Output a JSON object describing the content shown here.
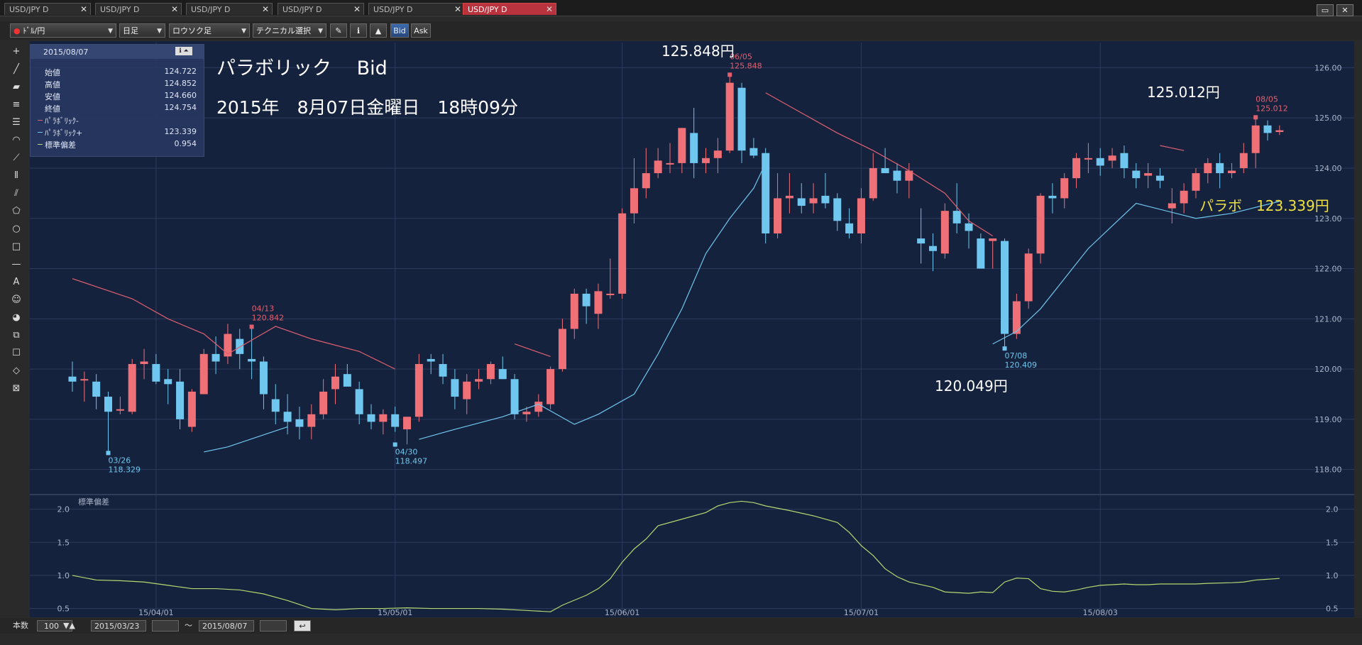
{
  "tabs": [
    {
      "label": "USD/JPY D",
      "active": false
    },
    {
      "label": "USD/JPY D",
      "active": false
    },
    {
      "label": "USD/JPY D",
      "active": false
    },
    {
      "label": "USD/JPY D",
      "active": false
    },
    {
      "label": "USD/JPY D",
      "active": false
    },
    {
      "label": "USD/JPY D",
      "active": true
    }
  ],
  "toolbar": {
    "pair": "ﾄﾞﾙ/円",
    "period": "日足",
    "chart_type": "ロウソク足",
    "technical": "テクニカル選択",
    "bid": "Bid",
    "ask": "Ask"
  },
  "info": {
    "date": "2015/08/07",
    "rows": [
      {
        "k": "始値",
        "v": "124.722",
        "color": ""
      },
      {
        "k": "高値",
        "v": "124.852",
        "color": ""
      },
      {
        "k": "安値",
        "v": "124.660",
        "color": ""
      },
      {
        "k": "終値",
        "v": "124.754",
        "color": ""
      },
      {
        "k": "ﾊﾟﾗﾎﾞﾘｯｸ-",
        "v": "",
        "color": "#e06070"
      },
      {
        "k": "ﾊﾟﾗﾎﾞﾘｯｸ+",
        "v": "123.339",
        "color": "#6fc6ee"
      },
      {
        "k": "標準偏差",
        "v": "0.954",
        "color": "#b5d870"
      }
    ]
  },
  "overlay": {
    "title": "パラボリック　 Bid",
    "datetime": "2015年　8月07日金曜日　18時09分",
    "high1": "125.848円",
    "high2": "125.012円",
    "low1": "120.049円",
    "parabo": "パラボ　123.339円"
  },
  "status": {
    "count_label": "本数",
    "count": "100",
    "from": "2015/03/23",
    "tilde": "～",
    "to": "2015/08/07"
  },
  "chart_data": {
    "type": "candlestick",
    "series_name": "USD/JPY D",
    "price_ylim": [
      117.6,
      126.5
    ],
    "price_ticks": [
      "118.00",
      "119.00",
      "120.00",
      "121.00",
      "122.00",
      "123.00",
      "124.00",
      "125.00",
      "126.00"
    ],
    "x_ticks": [
      {
        "i": 7,
        "label": "15/04/01"
      },
      {
        "i": 27,
        "label": "15/05/01"
      },
      {
        "i": 46,
        "label": "15/06/01"
      },
      {
        "i": 66,
        "label": "15/07/01"
      },
      {
        "i": 86,
        "label": "15/08/03"
      }
    ],
    "candles": [
      [
        119.85,
        120.15,
        119.55,
        119.75
      ],
      [
        119.8,
        119.95,
        119.35,
        119.8
      ],
      [
        119.75,
        119.9,
        119.2,
        119.45
      ],
      [
        119.45,
        119.55,
        118.33,
        119.15
      ],
      [
        119.2,
        119.45,
        119.1,
        119.2
      ],
      [
        119.15,
        120.2,
        119.1,
        120.1
      ],
      [
        120.1,
        120.4,
        119.8,
        120.15
      ],
      [
        120.1,
        120.3,
        119.7,
        119.75
      ],
      [
        119.8,
        120.0,
        119.3,
        119.7
      ],
      [
        119.75,
        120.0,
        118.8,
        119.0
      ],
      [
        118.85,
        119.6,
        118.75,
        119.55
      ],
      [
        119.5,
        120.4,
        119.5,
        120.3
      ],
      [
        120.3,
        120.65,
        119.9,
        120.15
      ],
      [
        120.25,
        120.9,
        120.1,
        120.7
      ],
      [
        120.6,
        120.8,
        120.0,
        120.3
      ],
      [
        120.2,
        120.84,
        119.8,
        120.15
      ],
      [
        120.15,
        120.25,
        119.2,
        119.5
      ],
      [
        119.4,
        119.7,
        118.9,
        119.15
      ],
      [
        119.15,
        119.5,
        118.7,
        118.95
      ],
      [
        119.0,
        119.25,
        118.6,
        118.85
      ],
      [
        118.85,
        119.3,
        118.6,
        119.1
      ],
      [
        119.1,
        119.8,
        119.0,
        119.55
      ],
      [
        119.6,
        120.1,
        119.3,
        119.85
      ],
      [
        119.9,
        120.1,
        119.7,
        119.65
      ],
      [
        119.6,
        119.75,
        118.9,
        119.1
      ],
      [
        119.1,
        119.3,
        118.8,
        118.95
      ],
      [
        118.95,
        119.2,
        118.7,
        119.1
      ],
      [
        119.1,
        119.25,
        118.75,
        118.85
      ],
      [
        118.8,
        119.05,
        118.5,
        119.05
      ],
      [
        119.05,
        120.3,
        118.95,
        120.1
      ],
      [
        120.2,
        120.3,
        119.9,
        120.15
      ],
      [
        120.1,
        120.3,
        119.7,
        119.85
      ],
      [
        119.8,
        120.0,
        119.2,
        119.45
      ],
      [
        119.4,
        119.9,
        119.1,
        119.75
      ],
      [
        119.75,
        120.0,
        119.6,
        119.8
      ],
      [
        119.8,
        120.15,
        119.7,
        120.1
      ],
      [
        120.0,
        120.25,
        119.8,
        119.8
      ],
      [
        119.8,
        119.9,
        119.0,
        119.1
      ],
      [
        119.1,
        119.25,
        118.95,
        119.15
      ],
      [
        119.15,
        119.5,
        119.05,
        119.35
      ],
      [
        119.3,
        120.05,
        119.2,
        120.0
      ],
      [
        120.0,
        121.0,
        119.95,
        120.8
      ],
      [
        120.8,
        121.6,
        120.6,
        121.5
      ],
      [
        121.5,
        121.6,
        120.9,
        121.25
      ],
      [
        121.1,
        121.7,
        120.8,
        121.55
      ],
      [
        121.5,
        122.2,
        121.4,
        121.5
      ],
      [
        121.5,
        123.2,
        121.4,
        123.1
      ],
      [
        123.1,
        124.2,
        122.9,
        123.6
      ],
      [
        123.6,
        124.4,
        123.4,
        123.9
      ],
      [
        123.9,
        124.4,
        123.8,
        124.15
      ],
      [
        124.1,
        124.5,
        123.9,
        124.1
      ],
      [
        124.1,
        124.8,
        123.9,
        124.8
      ],
      [
        124.7,
        125.2,
        123.8,
        124.1
      ],
      [
        124.1,
        124.4,
        123.9,
        124.2
      ],
      [
        124.2,
        124.6,
        123.9,
        124.35
      ],
      [
        124.35,
        125.86,
        124.3,
        125.7
      ],
      [
        125.6,
        125.7,
        124.1,
        124.35
      ],
      [
        124.4,
        124.6,
        124.2,
        124.25
      ],
      [
        124.3,
        124.4,
        122.5,
        122.7
      ],
      [
        122.7,
        123.9,
        122.6,
        123.4
      ],
      [
        123.4,
        123.9,
        123.1,
        123.45
      ],
      [
        123.4,
        123.7,
        123.1,
        123.25
      ],
      [
        123.3,
        123.7,
        123.1,
        123.4
      ],
      [
        123.45,
        123.9,
        123.2,
        123.3
      ],
      [
        123.4,
        123.5,
        122.75,
        122.95
      ],
      [
        122.9,
        123.2,
        122.6,
        122.7
      ],
      [
        122.7,
        123.6,
        122.5,
        123.4
      ],
      [
        123.4,
        124.3,
        123.35,
        124.0
      ],
      [
        124.0,
        124.4,
        123.9,
        123.9
      ],
      [
        123.95,
        124.1,
        123.5,
        123.75
      ],
      [
        123.75,
        124.1,
        123.4,
        123.95
      ],
      [
        122.6,
        123.2,
        122.1,
        122.5
      ],
      [
        122.45,
        122.7,
        121.95,
        122.35
      ],
      [
        122.3,
        123.3,
        122.2,
        123.15
      ],
      [
        123.15,
        123.7,
        122.7,
        122.9
      ],
      [
        122.9,
        123.1,
        122.4,
        122.75
      ],
      [
        122.6,
        122.7,
        122.0,
        122.0
      ],
      [
        122.55,
        122.6,
        122.0,
        122.6
      ],
      [
        122.55,
        122.6,
        120.409,
        120.7
      ],
      [
        120.7,
        121.5,
        120.6,
        121.35
      ],
      [
        121.35,
        122.4,
        121.2,
        122.3
      ],
      [
        122.3,
        123.5,
        122.1,
        123.45
      ],
      [
        123.45,
        123.7,
        123.1,
        123.4
      ],
      [
        123.4,
        123.9,
        123.2,
        123.8
      ],
      [
        123.8,
        124.3,
        123.6,
        124.2
      ],
      [
        124.2,
        124.5,
        123.9,
        124.2
      ],
      [
        124.2,
        124.4,
        123.85,
        124.05
      ],
      [
        124.15,
        124.4,
        124.0,
        124.25
      ],
      [
        124.3,
        124.45,
        123.8,
        124.0
      ],
      [
        123.95,
        124.1,
        123.6,
        123.8
      ],
      [
        123.85,
        124.1,
        123.6,
        123.9
      ],
      [
        123.85,
        124.0,
        123.6,
        123.75
      ],
      [
        123.2,
        123.6,
        122.9,
        123.3
      ],
      [
        123.3,
        123.7,
        123.1,
        123.55
      ],
      [
        123.55,
        124.0,
        123.4,
        123.9
      ],
      [
        123.9,
        124.2,
        123.7,
        124.1
      ],
      [
        124.1,
        124.3,
        123.6,
        123.9
      ],
      [
        123.9,
        124.1,
        123.8,
        123.95
      ],
      [
        124.0,
        124.5,
        123.9,
        124.3
      ],
      [
        124.3,
        125.012,
        124.0,
        124.85
      ],
      [
        124.85,
        124.95,
        124.55,
        124.7
      ],
      [
        124.72,
        124.852,
        124.66,
        124.754
      ]
    ],
    "parabolic_minus": [
      {
        "i": 0,
        "v": 121.8
      },
      {
        "i": 5,
        "v": 121.4
      },
      {
        "i": 8,
        "v": 121.0
      },
      {
        "i": 11,
        "v": 120.7
      },
      {
        "i": 13,
        "v": 120.3
      },
      {
        "i": 17,
        "v": 120.85
      },
      {
        "i": 20,
        "v": 120.6
      },
      {
        "i": 24,
        "v": 120.35
      },
      {
        "i": 27,
        "v": 120.0
      },
      {
        "i": 37,
        "v": 120.5
      },
      {
        "i": 40,
        "v": 120.25
      },
      {
        "i": 58,
        "v": 125.5
      },
      {
        "i": 61,
        "v": 125.1
      },
      {
        "i": 64,
        "v": 124.7
      },
      {
        "i": 67,
        "v": 124.35
      },
      {
        "i": 70,
        "v": 123.95
      },
      {
        "i": 73,
        "v": 123.5
      },
      {
        "i": 75,
        "v": 122.95
      },
      {
        "i": 77,
        "v": 122.65
      },
      {
        "i": 91,
        "v": 124.45
      },
      {
        "i": 93,
        "v": 124.35
      }
    ],
    "parabolic_plus": [
      {
        "i": 11,
        "v": 118.35
      },
      {
        "i": 13,
        "v": 118.45
      },
      {
        "i": 18,
        "v": 118.85
      },
      {
        "i": 29,
        "v": 118.6
      },
      {
        "i": 32,
        "v": 118.8
      },
      {
        "i": 36,
        "v": 119.05
      },
      {
        "i": 39,
        "v": 119.3
      },
      {
        "i": 42,
        "v": 118.9
      },
      {
        "i": 44,
        "v": 119.1
      },
      {
        "i": 47,
        "v": 119.5
      },
      {
        "i": 49,
        "v": 120.3
      },
      {
        "i": 51,
        "v": 121.2
      },
      {
        "i": 53,
        "v": 122.3
      },
      {
        "i": 55,
        "v": 123.0
      },
      {
        "i": 57,
        "v": 123.6
      },
      {
        "i": 58,
        "v": 124.1
      },
      {
        "i": 77,
        "v": 120.5
      },
      {
        "i": 79,
        "v": 120.75
      },
      {
        "i": 81,
        "v": 121.2
      },
      {
        "i": 83,
        "v": 121.8
      },
      {
        "i": 85,
        "v": 122.4
      },
      {
        "i": 87,
        "v": 122.85
      },
      {
        "i": 89,
        "v": 123.3
      },
      {
        "i": 94,
        "v": 123.0
      },
      {
        "i": 97,
        "v": 123.1
      },
      {
        "i": 101,
        "v": 123.339
      }
    ],
    "price_annotations": [
      {
        "i": 3,
        "v": 118.329,
        "date": "03/26",
        "value": "118.329",
        "pos": "below",
        "color": "#6fc6ee"
      },
      {
        "i": 15,
        "v": 120.842,
        "date": "04/13",
        "value": "120.842",
        "pos": "above",
        "color": "#e06070"
      },
      {
        "i": 27,
        "v": 118.497,
        "date": "04/30",
        "value": "118.497",
        "pos": "below",
        "color": "#6fc6ee"
      },
      {
        "i": 55,
        "v": 125.86,
        "date": "06/05",
        "value": "125.848",
        "pos": "above",
        "color": "#e06070"
      },
      {
        "i": 78,
        "v": 120.409,
        "date": "07/08",
        "value": "120.409",
        "pos": "below",
        "color": "#6fc6ee"
      },
      {
        "i": 99,
        "v": 125.012,
        "date": "08/05",
        "value": "125.012",
        "pos": "above",
        "color": "#e06070"
      }
    ],
    "stddev_label": "標準偏差",
    "stddev_ylim": [
      0.42,
      2.2
    ],
    "stddev_ticks": [
      "0.5",
      "1.0",
      "1.5",
      "2.0"
    ],
    "stddev_values": [
      {
        "i": 0,
        "v": 1.0
      },
      {
        "i": 2,
        "v": 0.93
      },
      {
        "i": 4,
        "v": 0.92
      },
      {
        "i": 6,
        "v": 0.9
      },
      {
        "i": 8,
        "v": 0.85
      },
      {
        "i": 10,
        "v": 0.8
      },
      {
        "i": 12,
        "v": 0.8
      },
      {
        "i": 14,
        "v": 0.78
      },
      {
        "i": 16,
        "v": 0.72
      },
      {
        "i": 18,
        "v": 0.62
      },
      {
        "i": 20,
        "v": 0.5
      },
      {
        "i": 22,
        "v": 0.48
      },
      {
        "i": 24,
        "v": 0.5
      },
      {
        "i": 26,
        "v": 0.5
      },
      {
        "i": 28,
        "v": 0.51
      },
      {
        "i": 30,
        "v": 0.5
      },
      {
        "i": 32,
        "v": 0.5
      },
      {
        "i": 34,
        "v": 0.5
      },
      {
        "i": 36,
        "v": 0.49
      },
      {
        "i": 38,
        "v": 0.47
      },
      {
        "i": 40,
        "v": 0.45
      },
      {
        "i": 41,
        "v": 0.55
      },
      {
        "i": 43,
        "v": 0.7
      },
      {
        "i": 44,
        "v": 0.8
      },
      {
        "i": 45,
        "v": 0.95
      },
      {
        "i": 46,
        "v": 1.2
      },
      {
        "i": 47,
        "v": 1.4
      },
      {
        "i": 48,
        "v": 1.55
      },
      {
        "i": 49,
        "v": 1.75
      },
      {
        "i": 51,
        "v": 1.85
      },
      {
        "i": 53,
        "v": 1.95
      },
      {
        "i": 54,
        "v": 2.05
      },
      {
        "i": 55,
        "v": 2.1
      },
      {
        "i": 56,
        "v": 2.12
      },
      {
        "i": 57,
        "v": 2.1
      },
      {
        "i": 58,
        "v": 2.05
      },
      {
        "i": 60,
        "v": 1.98
      },
      {
        "i": 62,
        "v": 1.9
      },
      {
        "i": 64,
        "v": 1.8
      },
      {
        "i": 65,
        "v": 1.65
      },
      {
        "i": 66,
        "v": 1.45
      },
      {
        "i": 67,
        "v": 1.3
      },
      {
        "i": 68,
        "v": 1.1
      },
      {
        "i": 69,
        "v": 0.98
      },
      {
        "i": 70,
        "v": 0.9
      },
      {
        "i": 72,
        "v": 0.82
      },
      {
        "i": 73,
        "v": 0.75
      },
      {
        "i": 75,
        "v": 0.73
      },
      {
        "i": 76,
        "v": 0.75
      },
      {
        "i": 77,
        "v": 0.74
      },
      {
        "i": 78,
        "v": 0.9
      },
      {
        "i": 79,
        "v": 0.96
      },
      {
        "i": 80,
        "v": 0.95
      },
      {
        "i": 81,
        "v": 0.8
      },
      {
        "i": 82,
        "v": 0.76
      },
      {
        "i": 83,
        "v": 0.75
      },
      {
        "i": 84,
        "v": 0.78
      },
      {
        "i": 85,
        "v": 0.82
      },
      {
        "i": 86,
        "v": 0.85
      },
      {
        "i": 87,
        "v": 0.86
      },
      {
        "i": 88,
        "v": 0.87
      },
      {
        "i": 89,
        "v": 0.86
      },
      {
        "i": 90,
        "v": 0.86
      },
      {
        "i": 91,
        "v": 0.87
      },
      {
        "i": 92,
        "v": 0.87
      },
      {
        "i": 93,
        "v": 0.87
      },
      {
        "i": 94,
        "v": 0.87
      },
      {
        "i": 95,
        "v": 0.88
      },
      {
        "i": 97,
        "v": 0.89
      },
      {
        "i": 98,
        "v": 0.9
      },
      {
        "i": 99,
        "v": 0.93
      },
      {
        "i": 101,
        "v": 0.954
      }
    ],
    "colors": {
      "up": "#f07078",
      "down": "#6fc6ee",
      "parabolic_minus": "#e06070",
      "parabolic_plus": "#6fc6ee",
      "stddev": "#b5d870",
      "plot_bg": "#15223d",
      "grid": "#2c3b5d",
      "axis_text": "#aab4c8",
      "overlay_text": "#ffffff",
      "parabo_text": "#f0e040"
    }
  }
}
